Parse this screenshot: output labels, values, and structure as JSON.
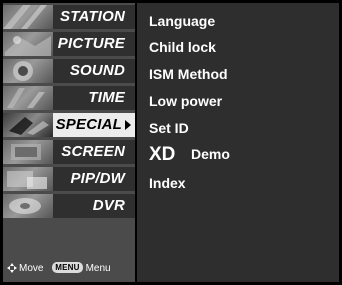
{
  "menu": {
    "items": [
      {
        "label": "STATION",
        "icon": "station-icon"
      },
      {
        "label": "PICTURE",
        "icon": "picture-icon"
      },
      {
        "label": "SOUND",
        "icon": "sound-icon"
      },
      {
        "label": "TIME",
        "icon": "time-icon"
      },
      {
        "label": "SPECIAL",
        "icon": "special-icon",
        "selected": true
      },
      {
        "label": "SCREEN",
        "icon": "screen-icon"
      },
      {
        "label": "PIP/DW",
        "icon": "pip-dw-icon"
      },
      {
        "label": "DVR",
        "icon": "dvr-icon"
      }
    ]
  },
  "options": {
    "language": "Language",
    "child_lock": "Child lock",
    "ism_method": "ISM Method",
    "low_power": "Low power",
    "set_id": "Set ID",
    "xd_logo": "XD",
    "xd_demo": "Demo",
    "index": "Index"
  },
  "hints": {
    "move": "Move",
    "menu_key": "MENU",
    "menu": "Menu"
  },
  "colors": {
    "panel_left": "#4b4b4b",
    "panel_right": "#2e2e2e",
    "selected_item": "#ececec",
    "frame": "#000000"
  }
}
